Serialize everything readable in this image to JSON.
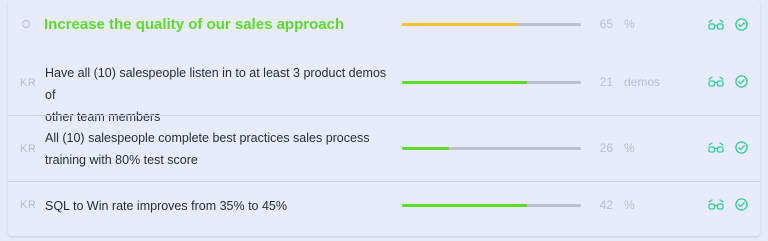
{
  "colors": {
    "accent_green": "#5ddb2b",
    "objective_bar": "#f2c230",
    "kr_bar": "#5ddb2b",
    "icon_teal": "#2fcf92"
  },
  "objective": {
    "tag": "O",
    "title": "Increase the quality of our sales approach",
    "value": "65",
    "unit": "%",
    "progress": 0.65,
    "icons": [
      "glasses-icon",
      "check-circle-icon"
    ]
  },
  "key_results": [
    {
      "tag": "KR",
      "text_line1": "Have all (10) salespeople listen in to at least 3 product demos of",
      "text_line2": "other team members",
      "value": "21",
      "unit": "demos",
      "progress": 0.7
    },
    {
      "tag": "KR",
      "text_line1": "All (10) salespeople complete best practices sales process",
      "text_line2": "training with 80% test score",
      "value": "26",
      "unit": "%",
      "progress": 0.26
    },
    {
      "tag": "KR",
      "text_line1": "SQL to Win rate improves from 35% to 45%",
      "value": "42",
      "unit": "%",
      "progress": 0.7
    }
  ]
}
